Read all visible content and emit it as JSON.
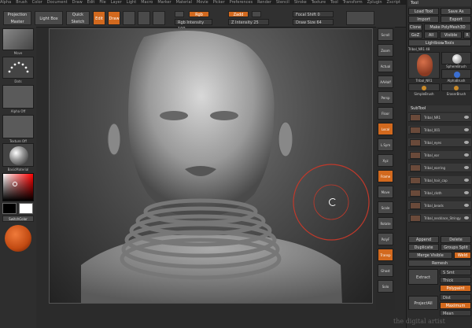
{
  "menubar": [
    "Alpha",
    "Brush",
    "Color",
    "Document",
    "Draw",
    "Edit",
    "File",
    "Layer",
    "Light",
    "Macro",
    "Marker",
    "Material",
    "Movie",
    "Picker",
    "Preferences",
    "Render",
    "Stencil",
    "Stroke",
    "Texture",
    "Tool",
    "Transform",
    "Zplugin",
    "Zscript"
  ],
  "toolbar": {
    "projection_master": "Projection Master",
    "lightbox": "Light Box",
    "quick_sketch": "Quick Sketch",
    "edit": "Edit",
    "draw": "Draw",
    "rgb_label": "Rgb",
    "rgb_intensity": "Rgb Intensity 100",
    "zadd_label": "Zadd",
    "z_intensity": "Z Intensity 25",
    "focal_shift": "Focal Shift 0",
    "draw_size": "Draw Size 64"
  },
  "left_panel": {
    "items": [
      {
        "caption": "Move"
      },
      {
        "caption": "Dots"
      },
      {
        "caption": "Alpha Off"
      },
      {
        "caption": "Texture Off"
      },
      {
        "caption": "BasicMaterial"
      }
    ],
    "switch_color": "SwitchColor",
    "color_main": "#d4551c"
  },
  "side_strip": [
    "Scroll",
    "Zoom",
    "Actual",
    "AAHalf",
    "Persp",
    "Floor",
    "Local",
    "L.Sym",
    "Xyz",
    "Frame",
    "Move",
    "Scale",
    "Rotate",
    "PolyF",
    "Transp",
    "Ghost",
    "Solo"
  ],
  "right_panel": {
    "title": "Tool",
    "buttons": {
      "load_tool": "Load Tool",
      "save_as": "Save As",
      "import": "Import",
      "export": "Export",
      "clone": "Clone",
      "make_polymesh": "Make PolyMesh3D",
      "goz": "GoZ",
      "all": "All",
      "visible": "Visible",
      "r": "R",
      "lightbox_tools": "Lightbox▸Tools",
      "current_tool": "Tribal_NR1 48"
    },
    "tools": [
      {
        "caption": "Tribal_NR1"
      },
      {
        "caption": "SphereBrush"
      },
      {
        "caption": "AlphaBrush"
      },
      {
        "caption": "SimpleBrush"
      },
      {
        "caption": "EraserBrush"
      }
    ],
    "subtool_header": "SubTool",
    "subtools": [
      "Tribal_NR1",
      "Tribal_001",
      "Tribal_eyes",
      "Tribal_ear",
      "Tribal_earring",
      "Tribal_hair_cap",
      "Tribal_cloth",
      "Tribal_beads",
      "Tribal_necklace_Stringy"
    ],
    "subtool_buttons": {
      "append": "Append",
      "delete": "Delete",
      "duplicate": "Duplicate",
      "groups_split": "Groups Split",
      "merge_visible": "Merge Visible",
      "weld": "Weld",
      "remesh": "Remesh"
    },
    "extras": {
      "extract": "Extract",
      "s_smt": "S Smt",
      "thick": "Thick",
      "polypaint": "Polypaint",
      "project_all": "ProjectAll",
      "dist": "Dist",
      "mean": "Mean",
      "maximum": "Maximum"
    }
  },
  "watermark": "the digital artist"
}
